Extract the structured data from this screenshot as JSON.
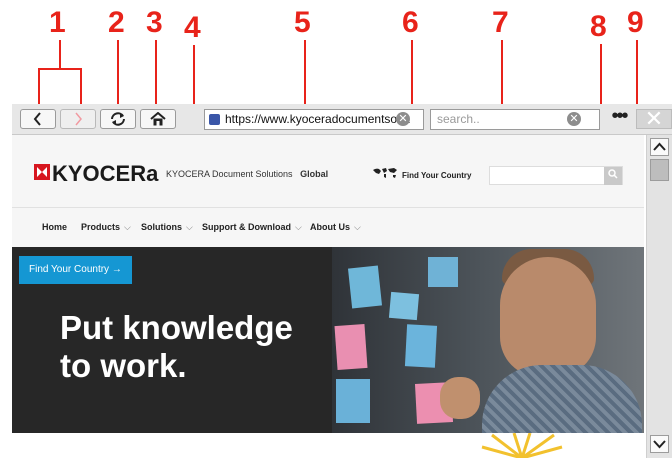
{
  "callouts": [
    "1",
    "2",
    "3",
    "4",
    "5",
    "6",
    "7",
    "8",
    "9"
  ],
  "toolbar": {
    "back_icon": "chevron-left-icon",
    "forward_icon": "chevron-right-icon",
    "refresh_icon": "refresh-icon",
    "home_icon": "home-icon",
    "lock_icon": "lock-icon",
    "url": "https://www.kyoceradocumentsolut",
    "clear_glyph": "✕",
    "search_placeholder": "search..",
    "more_glyph": "•••",
    "close_glyph": "✕"
  },
  "site": {
    "logo": "KYOCERa",
    "tagline_prefix": "KYOCERA Document Solutions",
    "tagline_suffix": "Global",
    "find_country": "Find Your Country",
    "search_icon": "search-icon",
    "nav": [
      "Home",
      "Products",
      "Solutions",
      "Support & Download",
      "About Us"
    ],
    "nav_chevron": "⌵",
    "hero_button": "Find Your Country →",
    "hero_line1": "Put knowledge",
    "hero_line2": "to work."
  },
  "colors": {
    "callout": "#e8231a",
    "brand_red": "#d7161f",
    "hero_button": "#1597d3"
  }
}
